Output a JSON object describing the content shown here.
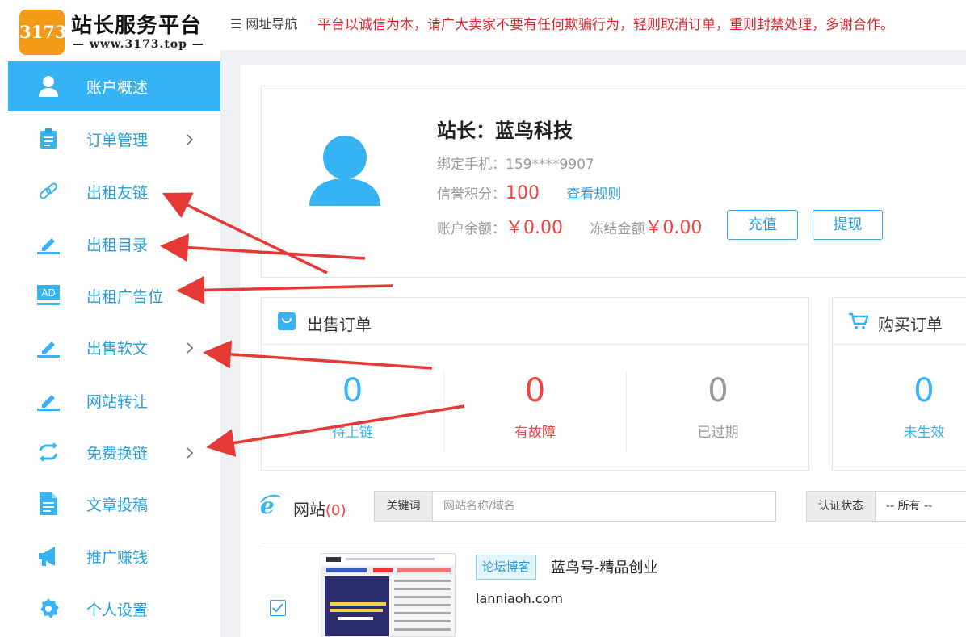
{
  "brand": {
    "badge": "3173",
    "title": "站长服务平台",
    "url": "— www.3173.top —",
    "badge_color": "#f39a19"
  },
  "accent_color": "#36b3f5",
  "sidebar": {
    "items": [
      {
        "label": "账户概述",
        "icon": "user-icon",
        "active": true,
        "has_arrow": false
      },
      {
        "label": "订单管理",
        "icon": "clipboard-icon",
        "active": false,
        "has_arrow": true
      },
      {
        "label": "出租友链",
        "icon": "link-icon",
        "active": false,
        "has_arrow": false
      },
      {
        "label": "出租目录",
        "icon": "edit-icon",
        "active": false,
        "has_arrow": false
      },
      {
        "label": "出租广告位",
        "icon": "ad-icon",
        "active": false,
        "has_arrow": false
      },
      {
        "label": "出售软文",
        "icon": "edit-icon",
        "active": false,
        "has_arrow": true
      },
      {
        "label": "网站转让",
        "icon": "edit-icon",
        "active": false,
        "has_arrow": false
      },
      {
        "label": "免费换链",
        "icon": "exchange-icon",
        "active": false,
        "has_arrow": true
      },
      {
        "label": "文章投稿",
        "icon": "document-icon",
        "active": false,
        "has_arrow": false
      },
      {
        "label": "推广赚钱",
        "icon": "megaphone-icon",
        "active": false,
        "has_arrow": false
      },
      {
        "label": "个人设置",
        "icon": "settings-icon",
        "active": false,
        "has_arrow": false
      }
    ]
  },
  "topbar": {
    "nav_label": "☰ 网址导航",
    "notice": "平台以诚信为本，请广大卖家不要有任何欺骗行为，轻则取消订单，重则封禁处理，多谢合作。"
  },
  "profile": {
    "owner": "站长：蓝鸟科技",
    "phone_label": "绑定手机：",
    "phone_value": "159****9907",
    "credit_label": "信誉积分：",
    "credit_value": "100",
    "rule_link": "查看规则",
    "balance_label": "账户余额：",
    "balance_value": "￥0.00",
    "frozen_label": "冻结金额",
    "frozen_value": "￥0.00",
    "recharge_button": "充值",
    "withdraw_button": "提现"
  },
  "sell_orders": {
    "title": "出售订单",
    "stats": [
      {
        "value": "0",
        "label": "待上链",
        "color": "#36b3f5"
      },
      {
        "value": "0",
        "label": "有故障",
        "color": "#f0423f"
      },
      {
        "value": "0",
        "label": "已过期",
        "color": "#999999"
      }
    ]
  },
  "buy_orders": {
    "title": "购买订单",
    "stats": [
      {
        "value": "0",
        "label": "未生效",
        "color": "#36b3f5"
      }
    ]
  },
  "sites": {
    "title": "网站",
    "count": "(0)",
    "keyword_label": "关键词",
    "keyword_placeholder": "网站名称/域名",
    "status_label": "认证状态",
    "status_value": "-- 所有 --",
    "rows": [
      {
        "category": "论坛博客",
        "name": "蓝鸟号-精品创业",
        "domain": "lanniaoh.com",
        "checked": true
      }
    ]
  }
}
